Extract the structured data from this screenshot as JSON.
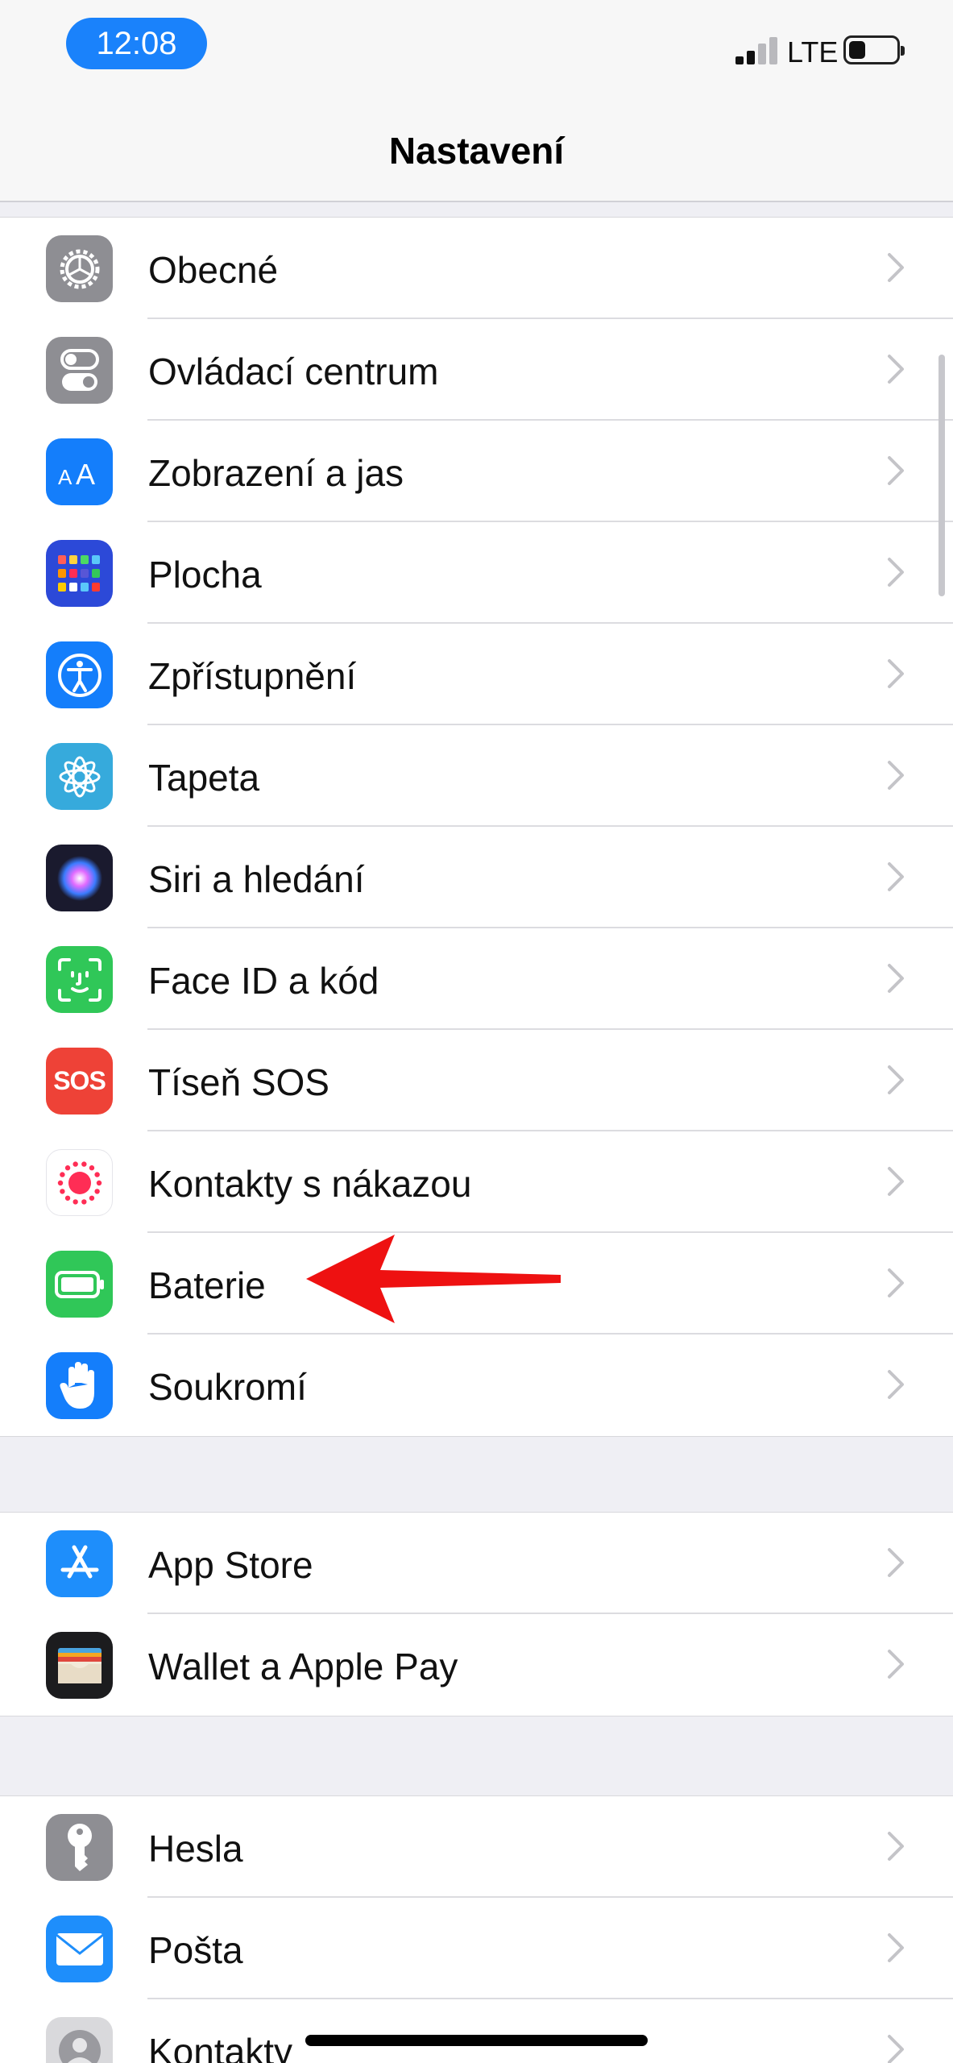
{
  "status": {
    "time": "12:08",
    "network": "LTE",
    "signal_bars": 2,
    "battery_level": 0.35
  },
  "nav": {
    "title": "Nastavení"
  },
  "groups": [
    {
      "items": [
        {
          "label": "Obecné",
          "icon": "gear-icon",
          "color": "#8e8e93"
        },
        {
          "label": "Ovládací centrum",
          "icon": "toggle-icon",
          "color": "#8e8e93"
        },
        {
          "label": "Zobrazení a jas",
          "icon": "text-size-icon",
          "color": "#147efb"
        },
        {
          "label": "Plocha",
          "icon": "home-screen-grid-icon",
          "color": "#2c49d8"
        },
        {
          "label": "Zpřístupnění",
          "icon": "accessibility-icon",
          "color": "#147efb"
        },
        {
          "label": "Tapeta",
          "icon": "flower-icon",
          "color": "#36aadc"
        },
        {
          "label": "Siri a hledání",
          "icon": "siri-icon",
          "color": "#1a1a2e"
        },
        {
          "label": "Face ID a kód",
          "icon": "face-id-icon",
          "color": "#30c758"
        },
        {
          "label": "Tíseň SOS",
          "icon": "sos-icon",
          "color": "#ee4237",
          "icon_text": "SOS"
        },
        {
          "label": "Kontakty s nákazou",
          "icon": "exposure-notification-icon",
          "color": "#ffffff"
        },
        {
          "label": "Baterie",
          "icon": "battery-icon",
          "color": "#30c758"
        },
        {
          "label": "Soukromí",
          "icon": "hand-icon",
          "color": "#147efb"
        }
      ]
    },
    {
      "items": [
        {
          "label": "App Store",
          "icon": "app-store-icon",
          "color": "#1e8efb"
        },
        {
          "label": "Wallet a Apple Pay",
          "icon": "wallet-icon",
          "color": "#1c1c1e"
        }
      ]
    },
    {
      "items": [
        {
          "label": "Hesla",
          "icon": "key-icon",
          "color": "#8e8e93"
        },
        {
          "label": "Pošta",
          "icon": "mail-icon",
          "color": "#1e8efb"
        },
        {
          "label": "Kontakty",
          "icon": "contacts-icon",
          "color": "#d9d9dc"
        }
      ]
    }
  ],
  "annotation": {
    "arrow_color": "#ee1111",
    "target": "Baterie"
  }
}
